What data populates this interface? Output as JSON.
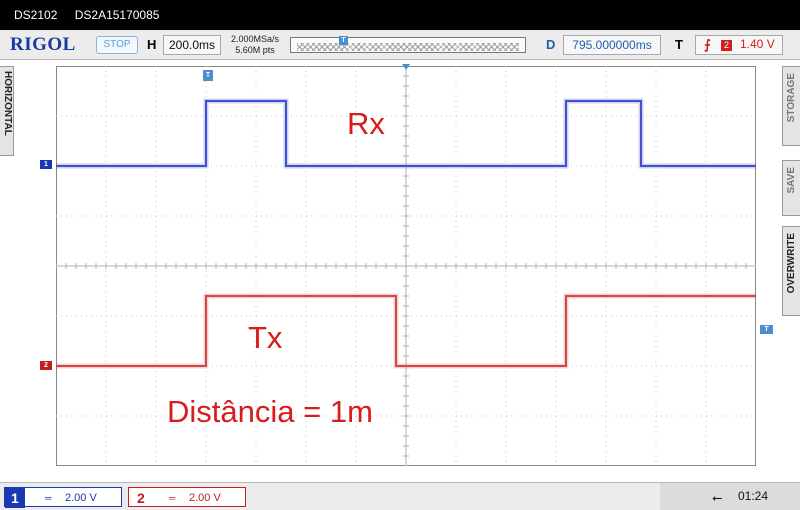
{
  "titlebar": {
    "model": "DS2102",
    "serial": "DS2A15170085"
  },
  "header": {
    "logo": "RIGOL",
    "run_state": "STOP",
    "h_label": "H",
    "timebase": "200.0ms",
    "sample_rate": "2.000MSa/s",
    "memory_depth": "5.60M pts",
    "trigger_marker_icon": "trigger-t-icon",
    "d_label": "D",
    "delay": "795.000000ms",
    "t_label": "T",
    "trigger_edge_icon": "rising-edge-icon",
    "trigger_source": "2",
    "trigger_level": "1.40 V"
  },
  "side_tabs": {
    "left": "HORIZONTAL",
    "right_storage": "STORAGE",
    "right_save": "SAVE",
    "right_overwrite": "OVERWRITE"
  },
  "markers": {
    "ch1": "1",
    "ch2": "2",
    "trigger": "T"
  },
  "annotations": {
    "rx": "Rx",
    "tx": "Tx",
    "distance": "Distância = 1m"
  },
  "colors": {
    "ch1": "#1a38b0",
    "ch2": "#c02020",
    "accent": "#4a8fd2",
    "annotation": "#d81c1c"
  },
  "footer": {
    "ch1": {
      "number": "1",
      "coupling": "═",
      "scale": "2.00 V"
    },
    "ch2": {
      "number": "2",
      "coupling": "═",
      "scale": "2.00 V"
    },
    "usb_icon": "usb-icon",
    "time": "01:24"
  },
  "chart_data": {
    "type": "line",
    "x_unit": "divisions",
    "y_unit": "divisions",
    "xlim": [
      0,
      14
    ],
    "ylim": [
      -4,
      4
    ],
    "series": [
      {
        "name": "Rx",
        "color": "#4050d0",
        "x": [
          0,
          3.0,
          3.0,
          4.6,
          4.6,
          10.2,
          10.2,
          11.7,
          11.7,
          14
        ],
        "y": [
          2.0,
          2.0,
          3.3,
          3.3,
          2.0,
          2.0,
          3.3,
          3.3,
          2.0,
          2.0
        ]
      },
      {
        "name": "Tx",
        "color": "#d04848",
        "x": [
          0,
          3.0,
          3.0,
          6.8,
          6.8,
          10.2,
          10.2,
          14
        ],
        "y": [
          -2.0,
          -2.0,
          -0.6,
          -0.6,
          -2.0,
          -2.0,
          -0.6,
          -0.6
        ]
      }
    ]
  }
}
